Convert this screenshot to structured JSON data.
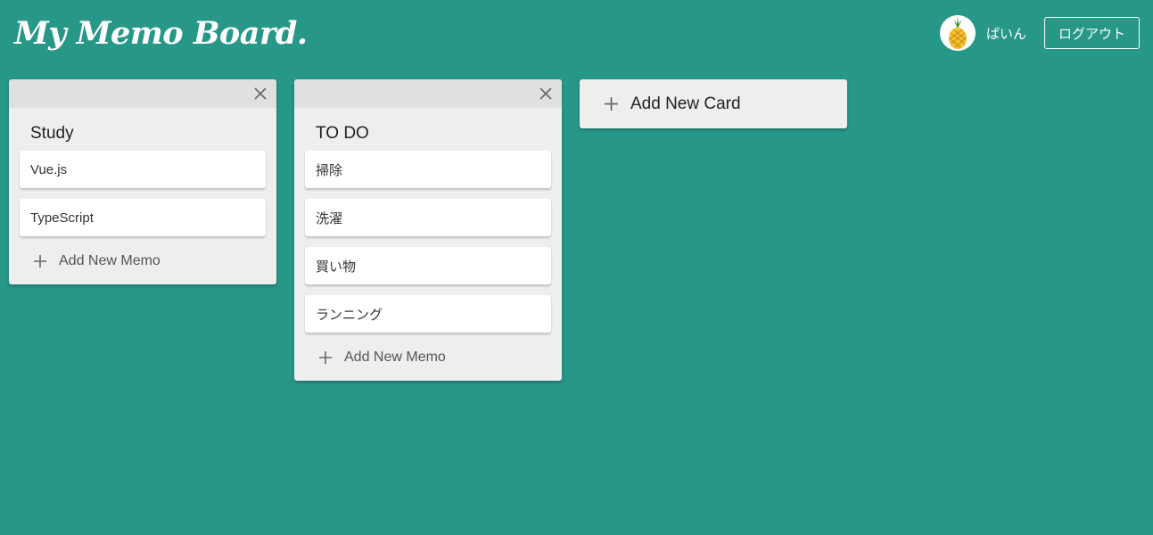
{
  "header": {
    "title": "My Memo Board.",
    "username": "ぱいん",
    "logout_label": "ログアウト"
  },
  "cards": [
    {
      "title": "Study",
      "memos": [
        "Vue.js",
        "TypeScript"
      ],
      "add_memo_label": "Add New Memo"
    },
    {
      "title": "TO DO",
      "memos": [
        "掃除",
        "洗濯",
        "買い物",
        "ランニング"
      ],
      "add_memo_label": "Add New Memo"
    }
  ],
  "add_card_label": "Add New Card",
  "icons": {
    "close": "close-icon",
    "add": "plus-icon",
    "avatar": "pineapple-icon"
  },
  "colors": {
    "background": "#279788",
    "card": "#eeeeee",
    "card_header": "#e0e0e0",
    "memo": "#ffffff"
  }
}
